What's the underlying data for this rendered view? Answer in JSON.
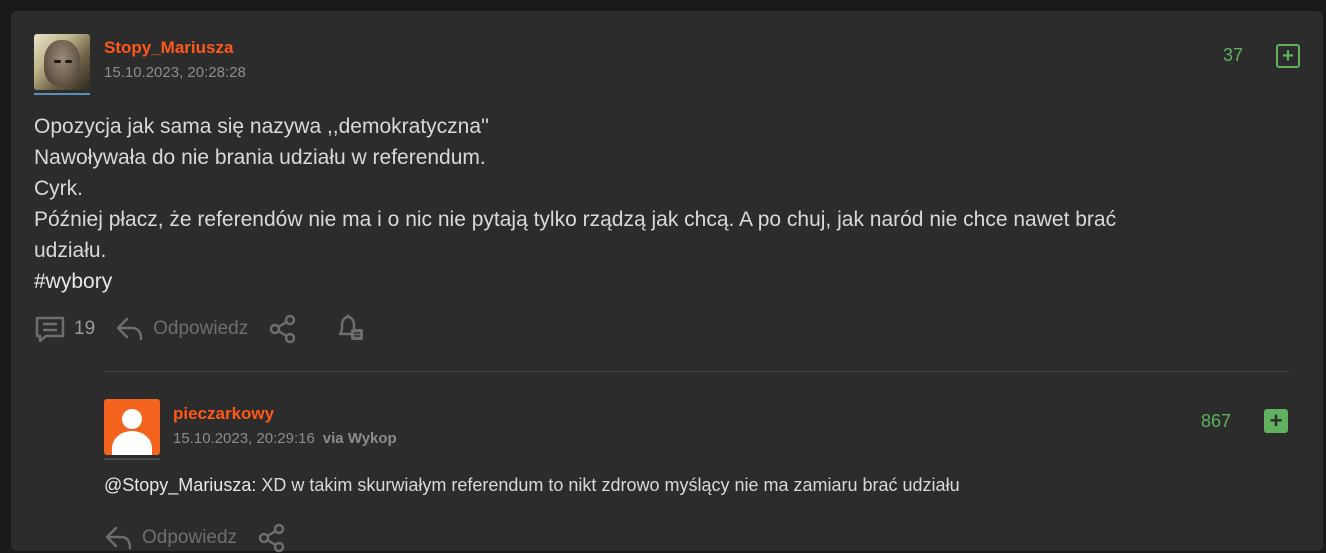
{
  "post": {
    "author": "Stopy_Mariusza",
    "timestamp": "15.10.2023, 20:28:28",
    "score": "37",
    "body_lines": [
      "Opozycja jak sama się nazywa ,,demokratyczna''",
      "Nawoływała do nie brania udziału w referendum.",
      "Cyrk.",
      "Później płacz, że referendów nie ma i o nic nie pytają tylko rządzą jak chcą. A po chuj, jak naród nie chce nawet brać",
      "udziału."
    ],
    "hashtag": "#wybory",
    "comment_count": "19",
    "reply_label": "Odpowiedz"
  },
  "reply": {
    "author": "pieczarkowy",
    "timestamp": "15.10.2023, 20:29:16",
    "via": "via Wykop",
    "score": "867",
    "mention": "@Stopy_Mariusza:",
    "text": " XD w takim skurwiałym referendum to nikt zdrowo myślący nie ma zamiaru brać udziału",
    "reply_label": "Odpowiedz"
  },
  "colors": {
    "username": "#ff5917",
    "score": "#5fb05f",
    "card_bg": "#2c2c2c",
    "page_bg": "#1a1a1a"
  },
  "icons": {
    "comments": "comments-icon",
    "reply": "reply-arrow-icon",
    "share": "share-icon",
    "observe": "bell-observe-icon",
    "upvote": "plus-icon"
  }
}
